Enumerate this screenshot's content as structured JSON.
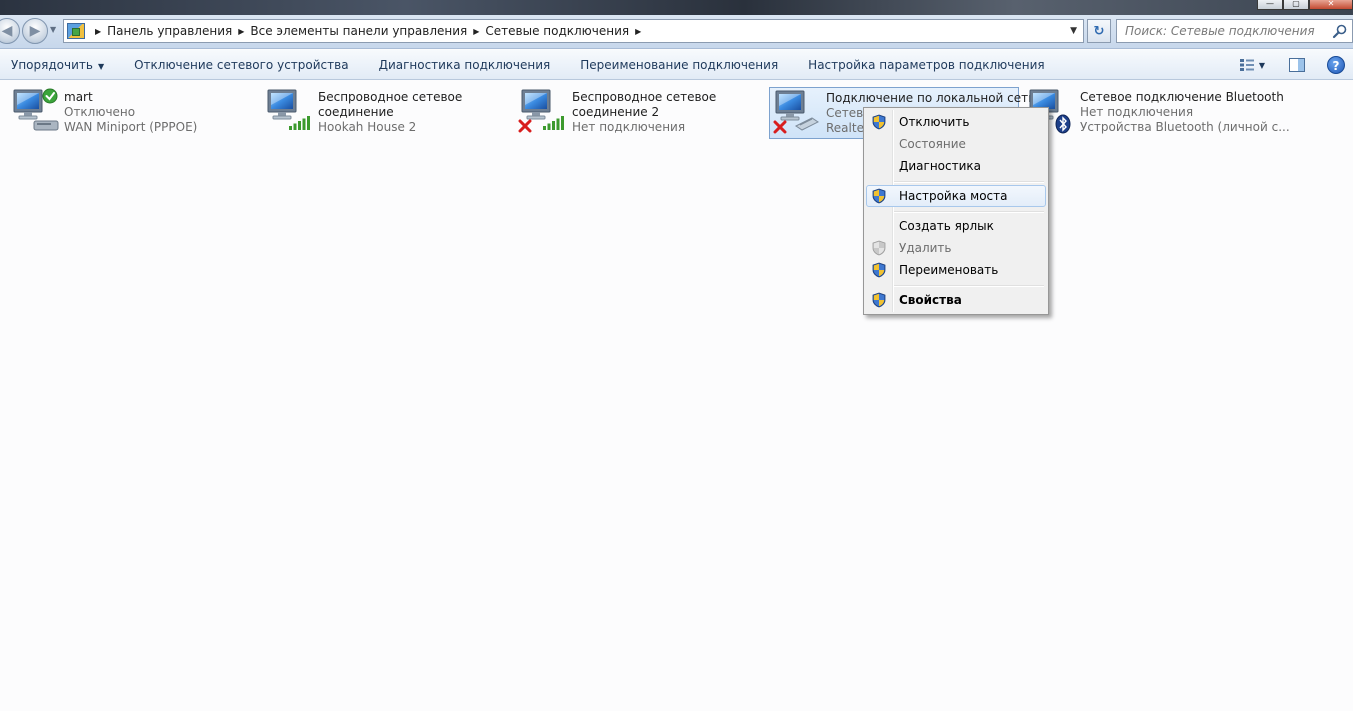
{
  "window": {
    "controls": {
      "minimize": "—",
      "maximize": "▢",
      "close": "✕"
    }
  },
  "navigation": {
    "back_glyph": "◀",
    "forward_glyph": "▶",
    "breadcrumbs": [
      "Панель управления",
      "Все элементы панели управления",
      "Сетевые подключения"
    ],
    "refresh_glyph": "↻",
    "search_placeholder": "Поиск: Сетевые подключения"
  },
  "toolbar": {
    "organize": "Упорядочить",
    "items": [
      "Отключение сетевого устройства",
      "Диагностика подключения",
      "Переименование подключения",
      "Настройка параметров подключения"
    ],
    "help_glyph": "?"
  },
  "connections": [
    {
      "name": "mart",
      "status": "Отключено",
      "device": "WAN Miniport (PPPOE)",
      "icon": "pppoe-connected-icon"
    },
    {
      "name": "Беспроводное сетевое",
      "name2": "соединение",
      "status": "Hookah House  2",
      "icon": "wireless-signal-icon"
    },
    {
      "name": "Беспроводное сетевое",
      "name2": "соединение 2",
      "status": "Нет подключения",
      "icon": "wireless-disconnected-icon"
    },
    {
      "name": "Подключение по локальной сети",
      "status": "Сетево",
      "device": "Realtek",
      "icon": "lan-disconnected-icon",
      "selected": true
    },
    {
      "name": "Сетевое подключение Bluetooth",
      "status": "Нет подключения",
      "device": "Устройства Bluetooth (личной с...",
      "icon": "bluetooth-icon"
    }
  ],
  "context_menu": {
    "items": [
      {
        "label": "Отключить",
        "shield": true,
        "disabled": false
      },
      {
        "label": "Состояние",
        "shield": false,
        "disabled": true
      },
      {
        "label": "Диагностика",
        "shield": false,
        "disabled": false
      },
      {
        "label": "Настройка моста",
        "shield": true,
        "disabled": false,
        "highlighted": true
      },
      {
        "label": "Создать ярлык",
        "shield": false,
        "disabled": false
      },
      {
        "label": "Удалить",
        "shield": true,
        "disabled": true
      },
      {
        "label": "Переименовать",
        "shield": true,
        "disabled": false
      },
      {
        "label": "Свойства",
        "shield": true,
        "disabled": false,
        "bold": true
      }
    ]
  },
  "colors": {
    "toolbar_text": "#1e395b",
    "disabled_text": "#6d6d6d",
    "selection_border": "#7da2ce",
    "signal_green": "#3c9a2e",
    "error_red": "#d81e1e"
  }
}
